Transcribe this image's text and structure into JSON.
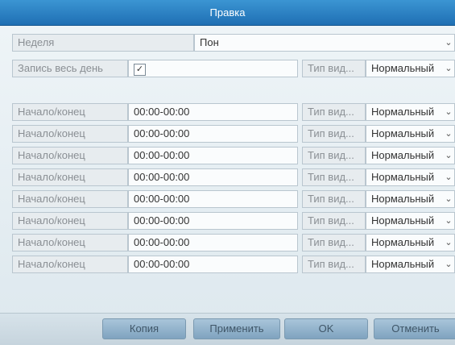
{
  "window": {
    "title": "Правка"
  },
  "week": {
    "label": "Неделя",
    "value": "Пон"
  },
  "all_day": {
    "label": "Запись весь день",
    "checked_mark": "✓",
    "type_label": "Тип вид...",
    "type_value": "Нормальный"
  },
  "periods": [
    {
      "label": "Начало/конец",
      "time": "00:00-00:00",
      "type_label": "Тип вид...",
      "type_value": "Нормальный"
    },
    {
      "label": "Начало/конец",
      "time": "00:00-00:00",
      "type_label": "Тип вид...",
      "type_value": "Нормальный"
    },
    {
      "label": "Начало/конец",
      "time": "00:00-00:00",
      "type_label": "Тип вид...",
      "type_value": "Нормальный"
    },
    {
      "label": "Начало/конец",
      "time": "00:00-00:00",
      "type_label": "Тип вид...",
      "type_value": "Нормальный"
    },
    {
      "label": "Начало/конец",
      "time": "00:00-00:00",
      "type_label": "Тип вид...",
      "type_value": "Нормальный"
    },
    {
      "label": "Начало/конец",
      "time": "00:00-00:00",
      "type_label": "Тип вид...",
      "type_value": "Нормальный"
    },
    {
      "label": "Начало/конец",
      "time": "00:00-00:00",
      "type_label": "Тип вид...",
      "type_value": "Нормальный"
    },
    {
      "label": "Начало/конец",
      "time": "00:00-00:00",
      "type_label": "Тип вид...",
      "type_value": "Нормальный"
    }
  ],
  "buttons": {
    "copy": "Копия",
    "apply": "Применить",
    "ok": "OK",
    "cancel": "Отменить"
  }
}
